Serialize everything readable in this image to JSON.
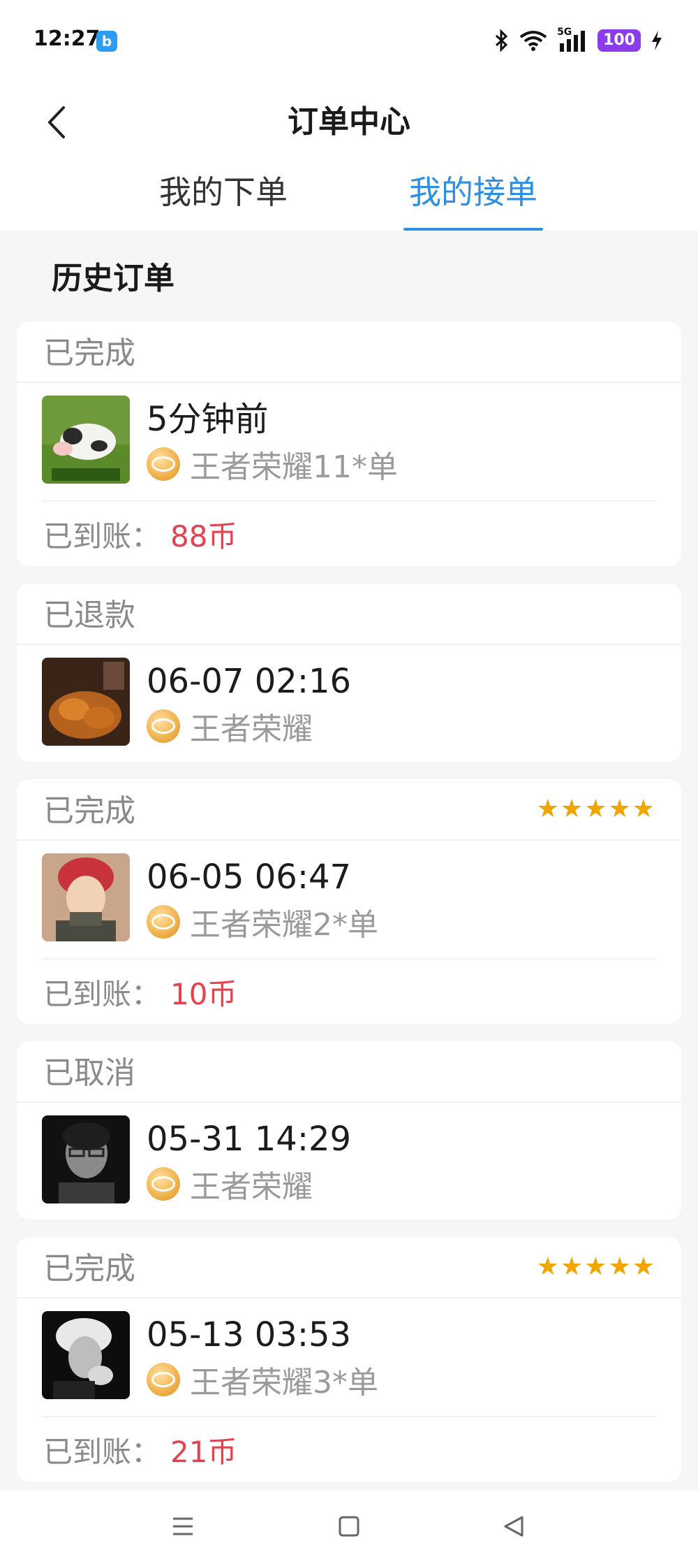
{
  "status_bar": {
    "time": "12:27",
    "app_icon": "b",
    "battery": "100",
    "network": "5G"
  },
  "header": {
    "title": "订单中心"
  },
  "tabs": [
    {
      "label": "我的下单",
      "active": false
    },
    {
      "label": "我的接单",
      "active": true
    }
  ],
  "section_title": "历史订单",
  "orders": [
    {
      "status": "已完成",
      "time": "5分钟前",
      "game": "王者荣耀11*单",
      "payout_label": "已到账：",
      "payout": "88币",
      "rating": ""
    },
    {
      "status": "已退款",
      "time": "06-07 02:16",
      "game": "王者荣耀",
      "rating": ""
    },
    {
      "status": "已完成",
      "time": "06-05 06:47",
      "game": "王者荣耀2*单",
      "payout_label": "已到账：",
      "payout": "10币",
      "rating": "★★★★★"
    },
    {
      "status": "已取消",
      "time": "05-31 14:29",
      "game": "王者荣耀",
      "rating": ""
    },
    {
      "status": "已完成",
      "time": "05-13 03:53",
      "game": "王者荣耀3*单",
      "payout_label": "已到账：",
      "payout": "21币",
      "rating": "★★★★★"
    }
  ],
  "colors": {
    "accent": "#2f8fe0",
    "payout": "#e5414f",
    "star": "#f0a500",
    "battery": "#8a3de8"
  }
}
